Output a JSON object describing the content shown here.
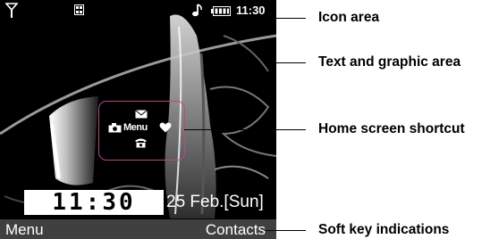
{
  "status_bar": {
    "time": "11:30",
    "icons": [
      "signal-icon",
      "grid-icon",
      "music-icon",
      "battery-icon"
    ]
  },
  "home_shortcut": {
    "center_label": "Menu",
    "icons": [
      "mail-icon",
      "camera-icon",
      "heart-icon",
      "phone-icon"
    ]
  },
  "clock": {
    "time": "11:30",
    "date": "25 Feb.[Sun]"
  },
  "softkeys": {
    "left": "Menu",
    "right": "Contacts"
  },
  "callouts": {
    "icon_area": "Icon area",
    "text_graphic_area": "Text and graphic area",
    "home_screen_shortcut": "Home screen shortcut",
    "soft_key_indications": "Soft key indications"
  },
  "colors": {
    "shortcut_border": "#b64a86",
    "softkey_bar": "#404040",
    "screen_background": "#000000"
  }
}
